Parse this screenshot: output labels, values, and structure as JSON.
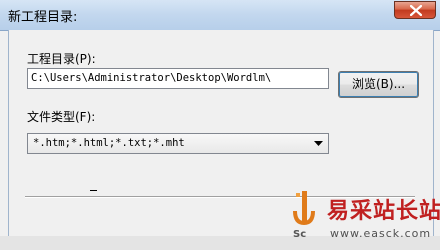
{
  "window": {
    "title": "新工程目录:"
  },
  "form": {
    "dir_label": "工程目录(P):",
    "dir_value": "C:\\Users\\Administrator\\Desktop\\Wordlm\\",
    "browse_label": "浏览(B)...",
    "type_label": "文件类型(F):",
    "type_value": "*.htm;*.html;*.txt;*.mht"
  },
  "status": {
    "marker": "_"
  },
  "watermark": {
    "logo_text": "Sc",
    "site_name": "易采站长站",
    "url": "www.easck.com"
  },
  "colors": {
    "titlebar": "#c2d7ee",
    "close_button": "#c23a1f",
    "watermark_red": "#c02020"
  }
}
